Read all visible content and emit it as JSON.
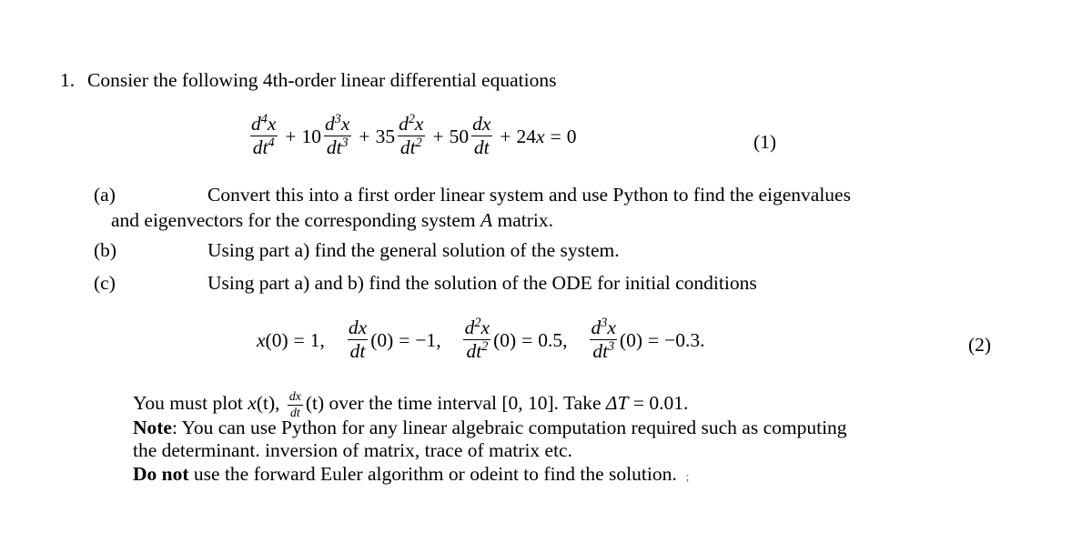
{
  "document": {
    "problem_number": "1.",
    "problem_statement": "Consier the following 4th-order linear differential equations",
    "equation_1": {
      "number": "(1)",
      "terms": {
        "t1_num_d": "d",
        "t1_num_pow": "4",
        "t1_num_var": "x",
        "t1_den_dt": "dt",
        "t1_den_pow": "4",
        "op1": "+",
        "coef1": "10",
        "t2_num_d": "d",
        "t2_num_pow": "3",
        "t2_num_var": "x",
        "t2_den_dt": "dt",
        "t2_den_pow": "3",
        "op2": "+",
        "coef2": "35",
        "t3_num_d": "d",
        "t3_num_pow": "2",
        "t3_num_var": "x",
        "t3_den_dt": "dt",
        "t3_den_pow": "2",
        "op3": "+",
        "coef3": "50",
        "t4_num": "dx",
        "t4_den": "dt",
        "op4": "+",
        "coef4": "24",
        "t5_var": "x",
        "equals": "=",
        "rhs": "0"
      }
    },
    "parts": [
      {
        "label": "(a)",
        "line1": "Convert this into a first order linear system and use Python to find the eigenvalues",
        "line2_pre": "and eigenvectors for the corresponding system ",
        "line2_italic": "A",
        "line2_post": " matrix."
      },
      {
        "label": "(b)",
        "line1": "Using part a) find the general solution of the system."
      },
      {
        "label": "(c)",
        "line1": "Using part a) and b) find the solution of the ODE for initial conditions"
      }
    ],
    "equation_2": {
      "number": "(2)",
      "conditions": {
        "c1_lhs_var": "x",
        "c1_lhs_arg": "(0)",
        "c1_equals": "=",
        "c1_value": "1,",
        "c2_num": "dx",
        "c2_den": "dt",
        "c2_arg": "(0)",
        "c2_equals": "=",
        "c2_value": "−1,",
        "c3_num_d": "d",
        "c3_num_pow": "2",
        "c3_num_var": "x",
        "c3_den_dt": "dt",
        "c3_den_pow": "2",
        "c3_arg": "(0)",
        "c3_equals": "=",
        "c3_value": "0.5,",
        "c4_num_d": "d",
        "c4_num_pow": "3",
        "c4_num_var": "x",
        "c4_den_dt": "dt",
        "c4_den_pow": "3",
        "c4_arg": "(0)",
        "c4_equals": "=",
        "c4_value": "−0.3."
      }
    },
    "closing": {
      "line1_pre": "You must plot ",
      "line1_xt": "x",
      "line1_xt_arg": "(t),",
      "line1_frac_num": "dx",
      "line1_frac_den": "dt",
      "line1_frac_arg": "(t)",
      "line1_mid": " over the time interval [0, 10]. Take ",
      "line1_delta": "ΔT",
      "line1_equals": " = ",
      "line1_value": "0.01.",
      "line2_bold": "Note",
      "line2_text": ": You can use Python for any linear algebraic computation required such as computing",
      "line3_text": "the determinant. inversion of matrix, trace of matrix etc.",
      "line4_bold": "Do not",
      "line4_text": " use the forward Euler algorithm or odeint to find the solution.",
      "line4_mark": ";"
    }
  },
  "colors": {
    "background": "#ffffff",
    "text": "#000000"
  }
}
